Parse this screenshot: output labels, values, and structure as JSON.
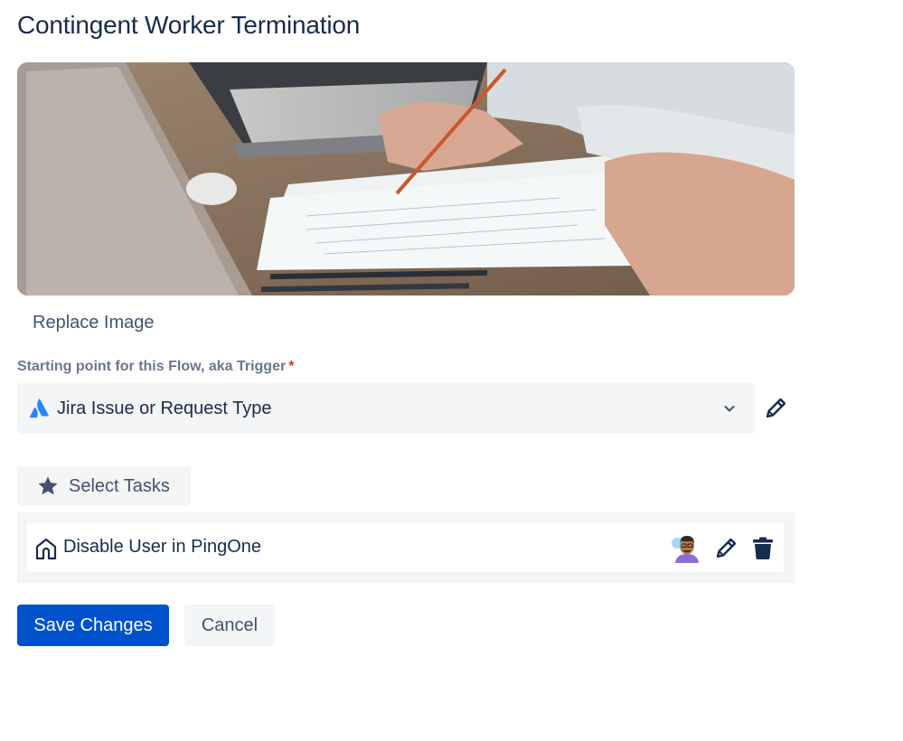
{
  "page": {
    "title": "Contingent Worker Termination"
  },
  "hero": {
    "replace_label": "Replace Image"
  },
  "trigger": {
    "label": "Starting point for this Flow, aka Trigger",
    "required_mark": "*",
    "value": "Jira Issue or Request Type",
    "icon": "atlassian-logo-icon",
    "edit_icon": "pencil-icon"
  },
  "tasks": {
    "select_label": "Select Tasks",
    "select_icon": "star-icon",
    "items": [
      {
        "icon": "home-icon",
        "name": "Disable User in PingOne",
        "assignee_icon": "avatar",
        "actions": [
          "pencil-icon",
          "trash-icon"
        ]
      }
    ]
  },
  "actions": {
    "save_label": "Save Changes",
    "cancel_label": "Cancel"
  },
  "colors": {
    "primary": "#0052cc",
    "text": "#172b4d",
    "subtle_text": "#6b778c",
    "required": "#de350b",
    "surface": "#f4f5f7"
  }
}
